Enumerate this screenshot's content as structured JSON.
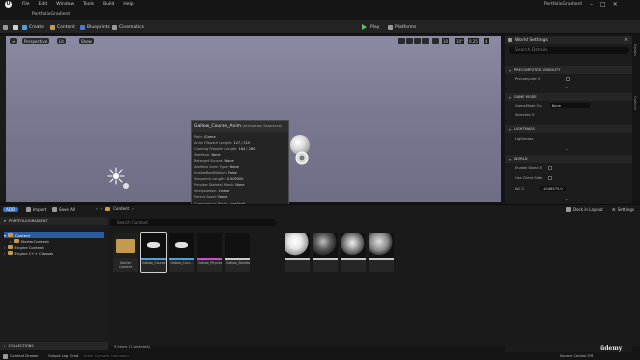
{
  "title_bar": {
    "logo": "U",
    "menu": [
      "File",
      "Edit",
      "Window",
      "Tools",
      "Build",
      "Help"
    ],
    "map_tab": "PortfolioGradient",
    "project": "PortfolioGradient",
    "controls": [
      "–",
      "□",
      "✕"
    ]
  },
  "toolbar": {
    "save_label": "Create",
    "content_label": "Content",
    "blueprints_label": "Blueprints",
    "cinematics_label": "Cinematics",
    "play_label": "Play",
    "platforms_label": "Platforms"
  },
  "viewport": {
    "perspective_label": "Perspective",
    "lit_label": "Lit",
    "show_label": "Show",
    "grid_snap": "10",
    "rot_snap": "10°",
    "scale_snap": "0.25",
    "cam_speed": "4"
  },
  "tooltip": {
    "title": "Gallow_Course_Anim",
    "subtitle": "(Animation Sequence)",
    "lines": [
      [
        "Path:",
        "/Game"
      ],
      [
        "Anim Filepath Length:",
        "127 / 210"
      ],
      [
        "Cooking Filepath Length:",
        "164 / 260"
      ],
      [
        "Skeleton:",
        "None"
      ],
      [
        "Retarget Source:",
        "None"
      ],
      [
        "Additive Anim Type:",
        "None"
      ],
      [
        "EnableRootMotion:",
        "False"
      ],
      [
        "Sequence Length:",
        "0.000000"
      ],
      [
        "Preview Skeletal Mesh:",
        "None"
      ],
      [
        "Interpolation:",
        "Linear"
      ],
      [
        "Parent Asset:",
        "None"
      ],
      [
        "Compression Ratio:",
        "-nan(ind)"
      ],
      [
        "Compressed Size (KB):",
        "0.00"
      ],
      [
        "Number Of Sampled Keys:",
        "0"
      ],
      [
        "Use Normalized Root Motion Scale:",
        "True"
      ],
      [
        "Retarget Source Asset:",
        "None"
      ],
      [
        "Import Resample Framerate:",
        "0"
      ],
      [
        "Import File Framerate:",
        "30.000000"
      ],
      [
        "Source Frame Rate:",
        "30.000000"
      ],
      [
        "Number Of Keys:",
        "0"
      ],
      [
        "Target Frame Rate:",
        "30.000000"
      ]
    ]
  },
  "world_settings": {
    "title": "World Settings",
    "search_placeholder": "Search Details",
    "sections": {
      "precomputed": "PRECOMPUTED VISIBILITY",
      "precomputed_prop": "Precompute V",
      "game_mode": "GAME MODE",
      "game_mode_prop": "GameMode Ov",
      "game_mode_value": "None",
      "selected_gm": "Selected G",
      "lightmass": "LIGHTMASS",
      "lightmass_prop": "Lightmass",
      "world": "WORLD",
      "world_prop1": "Enable World E",
      "world_prop2": "Use Client Side",
      "world_prop3": "Kill Z",
      "kill_z_value": "-1048575.0"
    },
    "rail_labels": [
      "Details",
      "Outliner"
    ]
  },
  "content_browser": {
    "tab_label": "Content Browser 1",
    "add_label": "ADD",
    "import_label": "Import",
    "save_all_label": "Save All",
    "crumb": "Content",
    "dock_label": "Dock in Layout",
    "settings_label": "Settings",
    "search_placeholder": "Search Content",
    "sources_header": "PORTFOLIOGRADIENT",
    "tree": [
      "Content",
      "StarterContent",
      "Engine Content",
      "Engine C++ Classes"
    ],
    "collections_header": "COLLECTIONS",
    "items_count": "9 items (1 selected)",
    "assets": [
      {
        "name": "Starter Content",
        "kind": "folder",
        "bar": ""
      },
      {
        "name": "Gallow_Course",
        "kind": "anim",
        "bar": "#4aa0e0"
      },
      {
        "name": "Gallow_Cour...",
        "kind": "anim",
        "bar": "#4aa0e0"
      },
      {
        "name": "Gallow_Physicsasset",
        "kind": "blank",
        "bar": "#d04ad0"
      },
      {
        "name": "Gallow_Skeleton",
        "kind": "blank",
        "bar": "#c8c8c8"
      },
      {
        "name": "",
        "kind": "sphere-white",
        "bar": "#c8c8c8"
      },
      {
        "name": "",
        "kind": "sphere-dark",
        "bar": "#c8c8c8"
      },
      {
        "name": "",
        "kind": "sphere-chrome",
        "bar": "#c8c8c8"
      },
      {
        "name": "",
        "kind": "sphere-gray",
        "bar": "#c8c8c8"
      }
    ]
  },
  "status_bar": {
    "drawer": "Content Drawer",
    "output": "Output Log",
    "cmd": "Cmd",
    "console_placeholder": "Enter Console Command",
    "source_control": "Source Control Off"
  },
  "watermark": "ūdemy"
}
